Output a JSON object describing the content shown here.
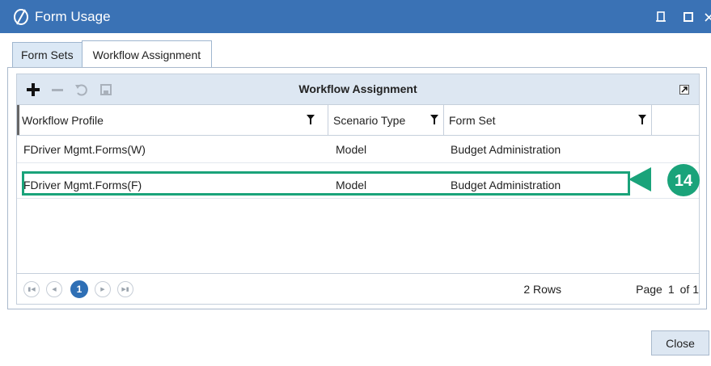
{
  "window": {
    "title": "Form Usage"
  },
  "tabs": [
    {
      "label": "Form Sets"
    },
    {
      "label": "Workflow Assignment"
    }
  ],
  "grid": {
    "title": "Workflow Assignment",
    "columns": [
      "Workflow Profile",
      "Scenario Type",
      "Form Set"
    ],
    "rows": [
      [
        "FDriver Mgmt.Forms(W)",
        "Model",
        "Budget Administration"
      ],
      [
        "FDriver Mgmt.Forms(F)",
        "Model",
        "Budget Administration"
      ]
    ],
    "pager": {
      "current_page": "1",
      "rows_label": "2 Rows",
      "page_label": "Page",
      "page_value": "1",
      "of_label": "of 1"
    }
  },
  "callout": {
    "number": "14",
    "color": "#1aa37a"
  },
  "buttons": {
    "close_label": "Close"
  },
  "colors": {
    "titlebar": "#3a72b5",
    "toolbar": "#dde7f2",
    "accent": "#2e6fb5"
  }
}
